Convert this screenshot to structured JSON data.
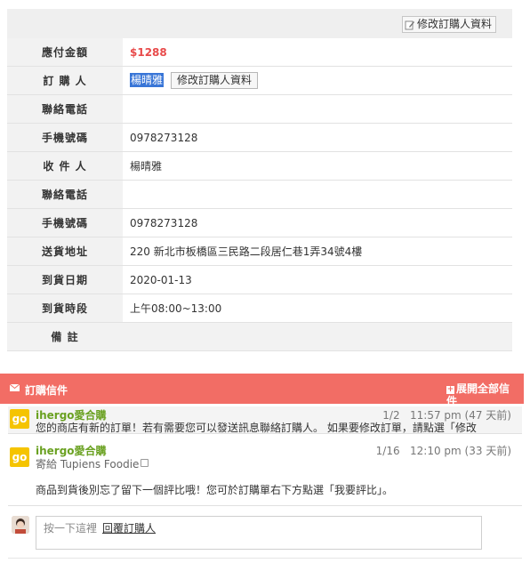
{
  "order_info": {
    "edit_top_label": "修改訂購人資料",
    "rows": [
      {
        "label": "應付金額",
        "value": "$1288"
      },
      {
        "label": "訂 購 人",
        "value": "楊晴雅",
        "button": "修改訂購人資料"
      },
      {
        "label": "聯絡電話",
        "value": ""
      },
      {
        "label": "手機號碼",
        "value": "0978273128"
      },
      {
        "label": "收 件 人",
        "value": "楊晴雅"
      },
      {
        "label": "聯絡電話",
        "value": ""
      },
      {
        "label": "手機號碼",
        "value": "0978273128"
      },
      {
        "label": "送貨地址",
        "value": "220 新北市板橋區三民路二段居仁巷1弄34號4樓"
      },
      {
        "label": "到貨日期",
        "value": "2020-01-13"
      },
      {
        "label": "到貨時段",
        "value": "上午08:00~13:00"
      },
      {
        "label": "備 註",
        "value": ""
      }
    ]
  },
  "mail": {
    "title": "訂購信件",
    "expand_label": "展開全部信件",
    "messages": [
      {
        "avatar": "go",
        "sender": "ihergo愛合購",
        "time": "1/2   11:57 pm (47 天前)",
        "snippet": "您的商店有新的訂單！若有需要您可以發送訊息聯絡訂購人。 如果要修改訂單，請點選「修改"
      },
      {
        "avatar": "go",
        "sender": "ihergo愛合購",
        "time": "1/16   12:10 pm (33 天前)",
        "to": "寄給 Tupiens Foodie",
        "body": "商品到貨後別忘了留下一個評比哦！您可於訂購單右下方點選「我要評比」。"
      }
    ],
    "reply": {
      "hint": "按一下這裡",
      "link": "回覆訂購人"
    }
  },
  "colors": {
    "accent": "#f26d65",
    "price": "#e84b4b",
    "sender": "#6aa121",
    "logo": "#f5c400"
  },
  "icons": [
    "pencil-icon",
    "mail-icon",
    "plus-icon",
    "lock-icon"
  ]
}
